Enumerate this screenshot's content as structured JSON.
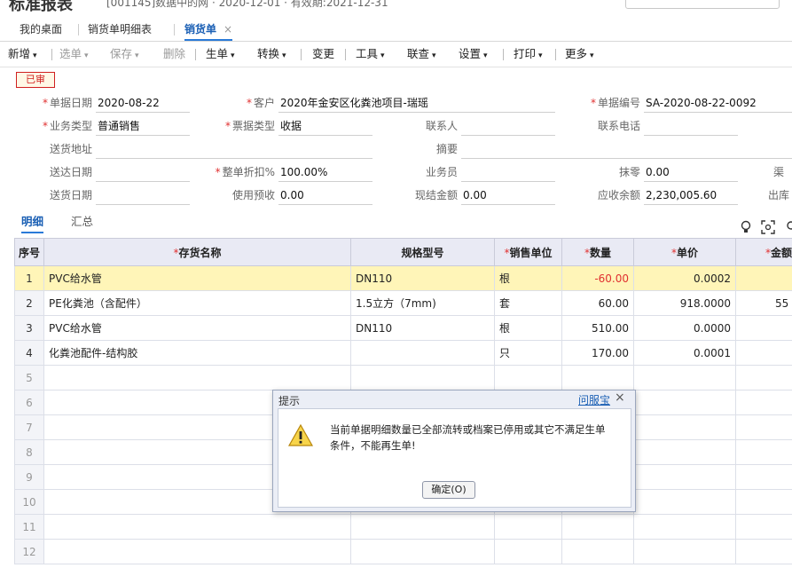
{
  "header": {
    "title": "标准报表",
    "meta": "[001145]数据中的网 · 2020-12-01 · 有效期:2021-12-31"
  },
  "tabs": [
    {
      "label": "我的桌面"
    },
    {
      "label": "销货单明细表"
    },
    {
      "label": "销货单",
      "close": "×"
    }
  ],
  "toolbar": {
    "new": "新增",
    "select": "选单",
    "save": "保存",
    "delete": "删除",
    "generate": "生单",
    "convert": "转换",
    "change": "变更",
    "tools": "工具",
    "linked_query": "联查",
    "settings": "设置",
    "print": "打印",
    "more": "更多",
    "caret": "▾"
  },
  "status_stamp": "已审",
  "form": {
    "doc_date": {
      "label": "单据日期",
      "value": "2020-08-22"
    },
    "customer": {
      "label": "客户",
      "value": "2020年金安区化粪池项目-瑞瑶"
    },
    "doc_no": {
      "label": "单据编号",
      "value": "SA-2020-08-22-0092"
    },
    "biz_type": {
      "label": "业务类型",
      "value": "普通销售"
    },
    "invoice_type": {
      "label": "票据类型",
      "value": "收据"
    },
    "contact": {
      "label": "联系人",
      "value": ""
    },
    "phone": {
      "label": "联系电话",
      "value": ""
    },
    "ship_addr": {
      "label": "送货地址",
      "value": ""
    },
    "memo": {
      "label": "摘要",
      "value": ""
    },
    "arrive_date": {
      "label": "送达日期",
      "value": ""
    },
    "discount": {
      "label": "整单折扣%",
      "value": "100.00%"
    },
    "salesman": {
      "label": "业务员",
      "value": ""
    },
    "round_off": {
      "label": "抹零",
      "value": "0.00"
    },
    "ship_date": {
      "label": "送货日期",
      "value": ""
    },
    "prepay": {
      "label": "使用预收",
      "value": "0.00"
    },
    "cash": {
      "label": "现结金额",
      "value": "0.00"
    },
    "receivable": {
      "label": "应收余额",
      "value": "2,230,005.60"
    },
    "right_clip_1": "渠",
    "right_clip_2": "出库"
  },
  "subtabs": {
    "detail": "明细",
    "summary": "汇总"
  },
  "grid": {
    "headers": {
      "seq": "序号",
      "name": "存货名称",
      "spec": "规格型号",
      "unit": "销售单位",
      "qty": "数量",
      "price": "单价",
      "amount": "金额"
    },
    "rows": [
      {
        "seq": "1",
        "name": "PVC给水管",
        "spec": "DN110",
        "unit": "根",
        "qty": "-60.00",
        "price": "0.0002",
        "amount": ""
      },
      {
        "seq": "2",
        "name": "PE化粪池（含配件）",
        "spec": "1.5立方（7mm)",
        "unit": "套",
        "qty": "60.00",
        "price": "918.0000",
        "amount": "55"
      },
      {
        "seq": "3",
        "name": "PVC给水管",
        "spec": "DN110",
        "unit": "根",
        "qty": "510.00",
        "price": "0.0000",
        "amount": ""
      },
      {
        "seq": "4",
        "name": "化粪池配件-结构胶",
        "spec": "",
        "unit": "只",
        "qty": "170.00",
        "price": "0.0001",
        "amount": ""
      },
      {
        "seq": "5"
      },
      {
        "seq": "6"
      },
      {
        "seq": "7"
      },
      {
        "seq": "8"
      },
      {
        "seq": "9"
      },
      {
        "seq": "10"
      },
      {
        "seq": "11"
      },
      {
        "seq": "12"
      }
    ]
  },
  "dialog": {
    "title": "提示",
    "help": "问服宝",
    "close": "×",
    "message": "当前单据明细数量已全部流转或档案已停用或其它不满足生单条件，不能再生单!",
    "ok": "确定(O)"
  },
  "colors": {
    "accent": "#2a7ad8",
    "required": "#e03030",
    "selected_row": "#fff5b8",
    "header_bg": "#e9eaf4"
  }
}
